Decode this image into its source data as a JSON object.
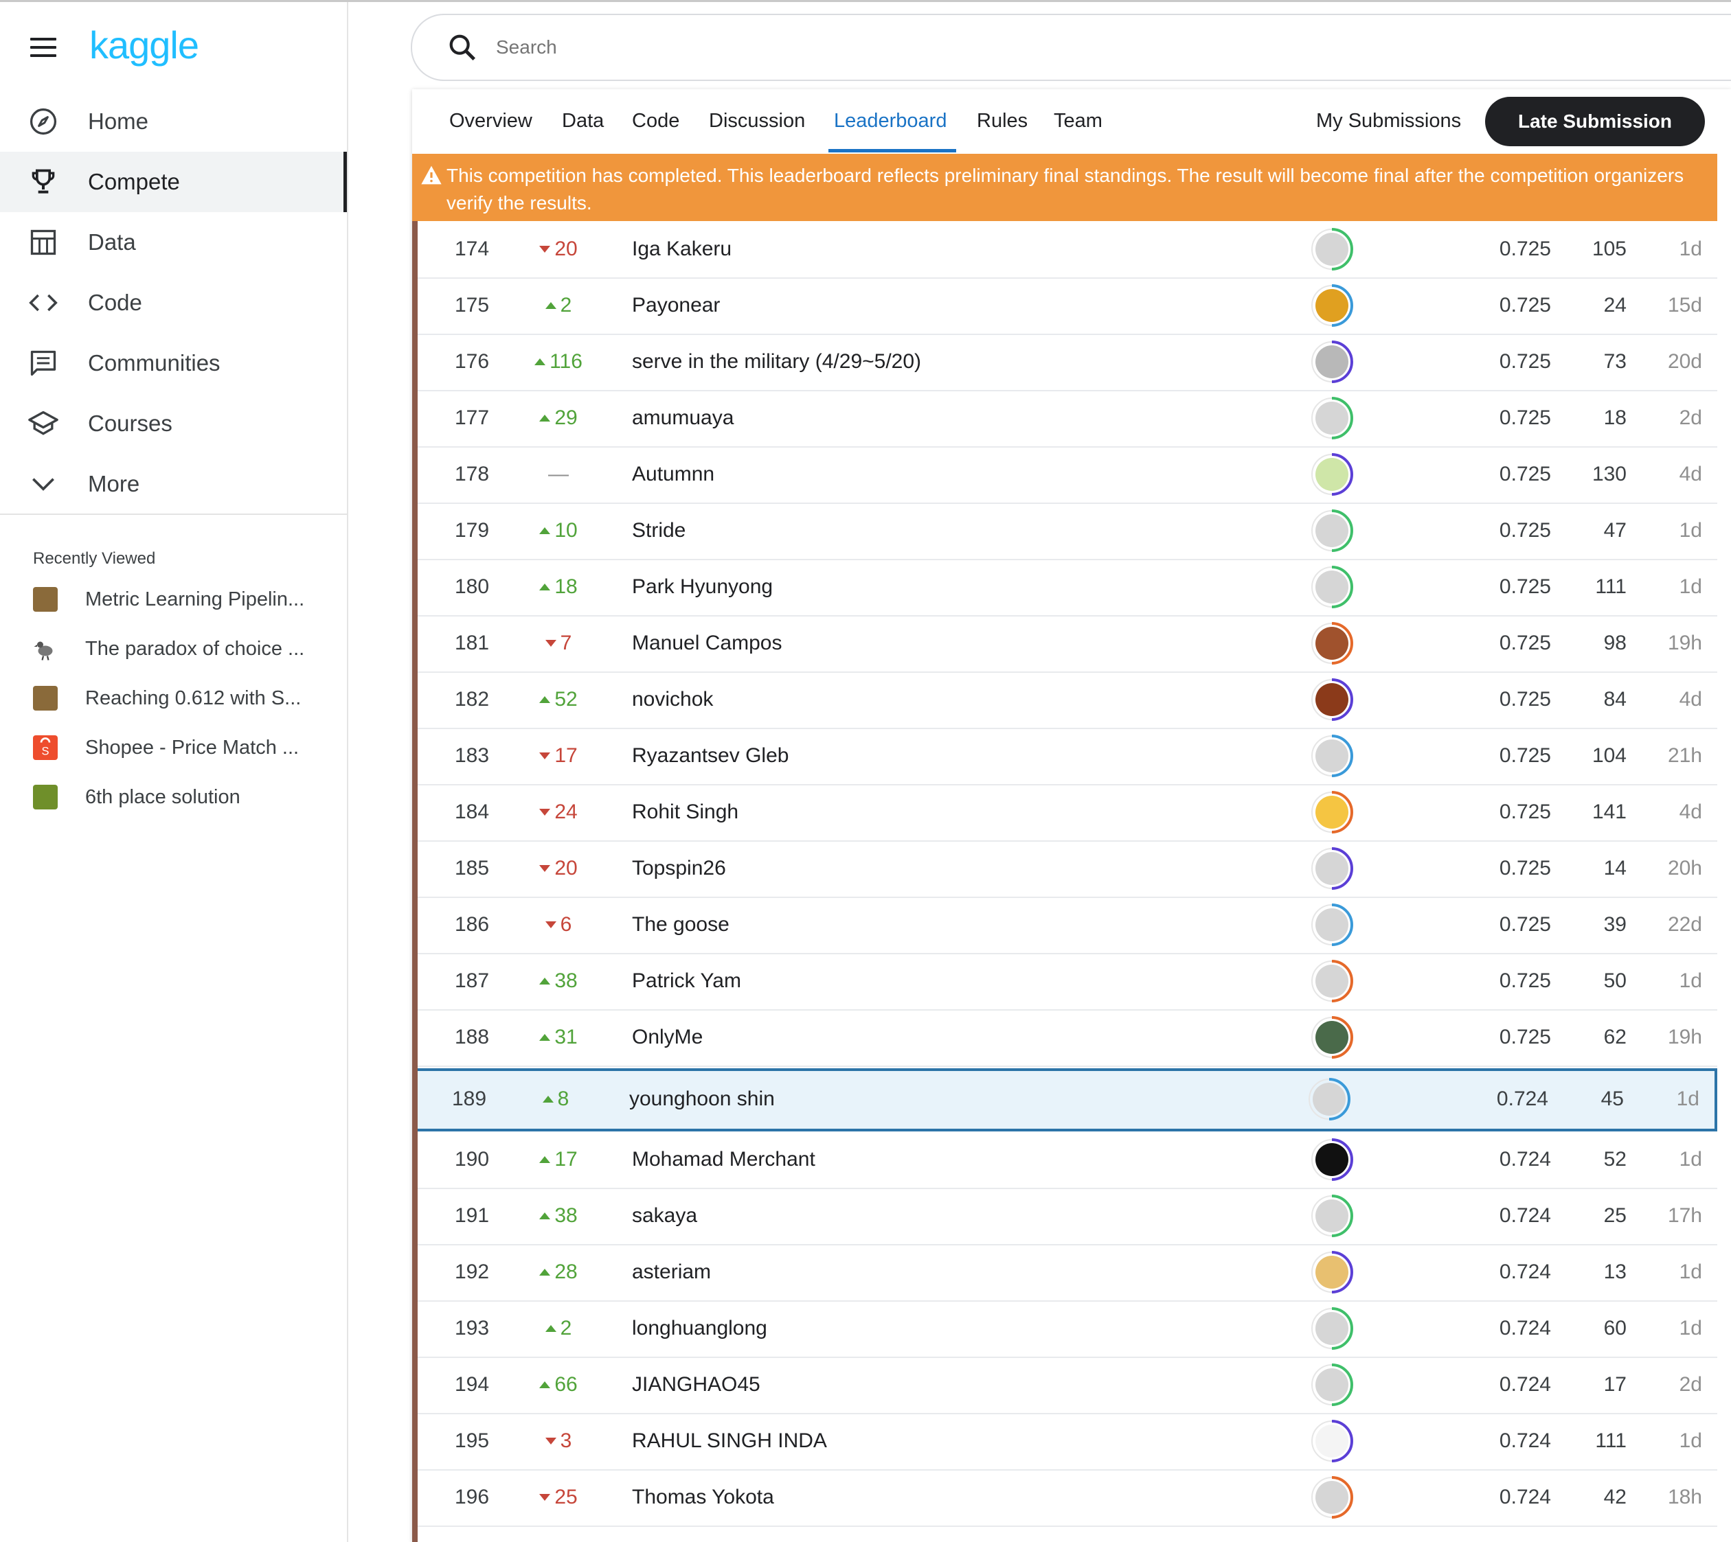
{
  "app": {
    "logo": "kaggle"
  },
  "sidebar": {
    "items": [
      {
        "label": "Home",
        "icon": "compass-icon"
      },
      {
        "label": "Compete",
        "icon": "trophy-icon",
        "active": true
      },
      {
        "label": "Data",
        "icon": "table-icon"
      },
      {
        "label": "Code",
        "icon": "code-icon"
      },
      {
        "label": "Communities",
        "icon": "comment-icon"
      },
      {
        "label": "Courses",
        "icon": "school-icon"
      },
      {
        "label": "More",
        "icon": "chevron-down-icon"
      }
    ],
    "recently_viewed_title": "Recently Viewed",
    "recent": [
      {
        "label": "Metric Learning Pipelin...",
        "thumb_color": "#8a6a3a"
      },
      {
        "label": "The paradox of choice ...",
        "thumb_color": "#777777"
      },
      {
        "label": "Reaching 0.612 with S...",
        "thumb_color": "#8a6a3a"
      },
      {
        "label": "Shopee - Price Match ...",
        "thumb_color": "#ee4d2d"
      },
      {
        "label": "6th place solution",
        "thumb_color": "#6f8f2a"
      }
    ]
  },
  "search": {
    "placeholder": "Search"
  },
  "tabs": [
    "Overview",
    "Data",
    "Code",
    "Discussion",
    "Leaderboard",
    "Rules",
    "Team"
  ],
  "active_tab": "Leaderboard",
  "my_submissions": "My Submissions",
  "late_submission": "Late Submission",
  "banner": {
    "text": "This competition has completed. This leaderboard reflects preliminary final standings. The result will become final after the competition organizers verify the results."
  },
  "colors": {
    "accent": "#1a73c5",
    "banner": "#f0963c",
    "up": "#51a33a",
    "down": "#c6463a",
    "highlight_border": "#2c74a8",
    "highlight_bg": "#e8f3fa"
  },
  "leaderboard": [
    {
      "rank": "174",
      "dir": "down",
      "delta": "20",
      "team": "Iga Kakeru",
      "score": "0.725",
      "entries": "105",
      "last": "1d",
      "ring": "#3fbf6a",
      "avatar": "#d6d6d6"
    },
    {
      "rank": "175",
      "dir": "up",
      "delta": "2",
      "team": "Payonear",
      "score": "0.725",
      "entries": "24",
      "last": "15d",
      "ring": "#3a9ad9",
      "avatar": "#e0a020"
    },
    {
      "rank": "176",
      "dir": "up",
      "delta": "116",
      "team": "serve in the military (4/29~5/20)",
      "score": "0.725",
      "entries": "73",
      "last": "20d",
      "ring": "#5b3fd6",
      "avatar": "#b8b8b8"
    },
    {
      "rank": "177",
      "dir": "up",
      "delta": "29",
      "team": "amumuaya",
      "score": "0.725",
      "entries": "18",
      "last": "2d",
      "ring": "#3fbf6a",
      "avatar": "#d6d6d6"
    },
    {
      "rank": "178",
      "dir": "none",
      "delta": "—",
      "team": "Autumnn",
      "score": "0.725",
      "entries": "130",
      "last": "4d",
      "ring": "#5b3fd6",
      "avatar": "#cfe6a8"
    },
    {
      "rank": "179",
      "dir": "up",
      "delta": "10",
      "team": "Stride",
      "score": "0.725",
      "entries": "47",
      "last": "1d",
      "ring": "#3fbf6a",
      "avatar": "#d6d6d6"
    },
    {
      "rank": "180",
      "dir": "up",
      "delta": "18",
      "team": "Park Hyunyong",
      "score": "0.725",
      "entries": "111",
      "last": "1d",
      "ring": "#3fbf6a",
      "avatar": "#d6d6d6"
    },
    {
      "rank": "181",
      "dir": "down",
      "delta": "7",
      "team": "Manuel Campos",
      "score": "0.725",
      "entries": "98",
      "last": "19h",
      "ring": "#e5692a",
      "avatar": "#a0522d"
    },
    {
      "rank": "182",
      "dir": "up",
      "delta": "52",
      "team": "novichok",
      "score": "0.725",
      "entries": "84",
      "last": "4d",
      "ring": "#5b3fd6",
      "avatar": "#8b3a1a"
    },
    {
      "rank": "183",
      "dir": "down",
      "delta": "17",
      "team": "Ryazantsev Gleb",
      "score": "0.725",
      "entries": "104",
      "last": "21h",
      "ring": "#3a9ad9",
      "avatar": "#d6d6d6"
    },
    {
      "rank": "184",
      "dir": "down",
      "delta": "24",
      "team": "Rohit Singh",
      "score": "0.725",
      "entries": "141",
      "last": "4d",
      "ring": "#e5692a",
      "avatar": "#f5c542"
    },
    {
      "rank": "185",
      "dir": "down",
      "delta": "20",
      "team": "Topspin26",
      "score": "0.725",
      "entries": "14",
      "last": "20h",
      "ring": "#5b3fd6",
      "avatar": "#d6d6d6"
    },
    {
      "rank": "186",
      "dir": "down",
      "delta": "6",
      "team": "The goose",
      "score": "0.725",
      "entries": "39",
      "last": "22d",
      "ring": "#3a9ad9",
      "avatar": "#d6d6d6"
    },
    {
      "rank": "187",
      "dir": "up",
      "delta": "38",
      "team": "Patrick Yam",
      "score": "0.725",
      "entries": "50",
      "last": "1d",
      "ring": "#e5692a",
      "avatar": "#d6d6d6"
    },
    {
      "rank": "188",
      "dir": "up",
      "delta": "31",
      "team": "OnlyMe",
      "score": "0.725",
      "entries": "62",
      "last": "19h",
      "ring": "#e5692a",
      "avatar": "#4a6a4a"
    },
    {
      "rank": "189",
      "dir": "up",
      "delta": "8",
      "team": "younghoon shin",
      "score": "0.724",
      "entries": "45",
      "last": "1d",
      "ring": "#3a9ad9",
      "avatar": "#d6d6d6",
      "highlight": true
    },
    {
      "rank": "190",
      "dir": "up",
      "delta": "17",
      "team": "Mohamad Merchant",
      "score": "0.724",
      "entries": "52",
      "last": "1d",
      "ring": "#5b3fd6",
      "avatar": "#111111"
    },
    {
      "rank": "191",
      "dir": "up",
      "delta": "38",
      "team": "sakaya",
      "score": "0.724",
      "entries": "25",
      "last": "17h",
      "ring": "#3fbf6a",
      "avatar": "#d6d6d6"
    },
    {
      "rank": "192",
      "dir": "up",
      "delta": "28",
      "team": "asteriam",
      "score": "0.724",
      "entries": "13",
      "last": "1d",
      "ring": "#5b3fd6",
      "avatar": "#e8c070"
    },
    {
      "rank": "193",
      "dir": "up",
      "delta": "2",
      "team": "longhuanglong",
      "score": "0.724",
      "entries": "60",
      "last": "1d",
      "ring": "#3fbf6a",
      "avatar": "#d6d6d6"
    },
    {
      "rank": "194",
      "dir": "up",
      "delta": "66",
      "team": "JIANGHAO45",
      "score": "0.724",
      "entries": "17",
      "last": "2d",
      "ring": "#3fbf6a",
      "avatar": "#d6d6d6"
    },
    {
      "rank": "195",
      "dir": "down",
      "delta": "3",
      "team": "RAHUL SINGH INDA",
      "score": "0.724",
      "entries": "111",
      "last": "1d",
      "ring": "#5b3fd6",
      "avatar": "#f4f4f4"
    },
    {
      "rank": "196",
      "dir": "down",
      "delta": "25",
      "team": "Thomas Yokota",
      "score": "0.724",
      "entries": "42",
      "last": "18h",
      "ring": "#e5692a",
      "avatar": "#d6d6d6"
    }
  ]
}
